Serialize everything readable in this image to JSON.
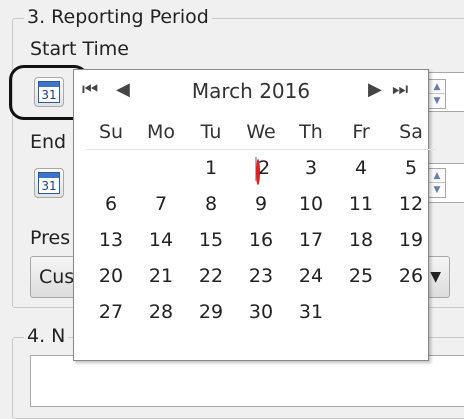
{
  "group_reporting": {
    "legend": "3. Reporting Period"
  },
  "start_time": {
    "label": "Start Time",
    "calendar_icon_text": "31"
  },
  "end_time": {
    "label": "End",
    "calendar_icon_text": "31"
  },
  "preset": {
    "label": "Pres",
    "value": "Cus"
  },
  "group_next": {
    "legend": "4. N"
  },
  "calendar": {
    "month_label": "March 2016",
    "nav": {
      "prev_year": "⏮",
      "prev_month": "◀",
      "next_month": "▶",
      "next_year": "⏭"
    },
    "weekdays": [
      "Su",
      "Mo",
      "Tu",
      "We",
      "Th",
      "Fr",
      "Sa"
    ],
    "weeks": [
      [
        "",
        "",
        "1",
        "2",
        "3",
        "4",
        "5"
      ],
      [
        "6",
        "7",
        "8",
        "9",
        "10",
        "11",
        "12"
      ],
      [
        "13",
        "14",
        "15",
        "16",
        "17",
        "18",
        "19"
      ],
      [
        "20",
        "21",
        "22",
        "23",
        "24",
        "25",
        "26"
      ],
      [
        "27",
        "28",
        "29",
        "30",
        "31",
        "",
        ""
      ]
    ],
    "today": "2"
  },
  "colors": {
    "today_ring": "#e02020",
    "icon_blue": "#3d74c6"
  }
}
